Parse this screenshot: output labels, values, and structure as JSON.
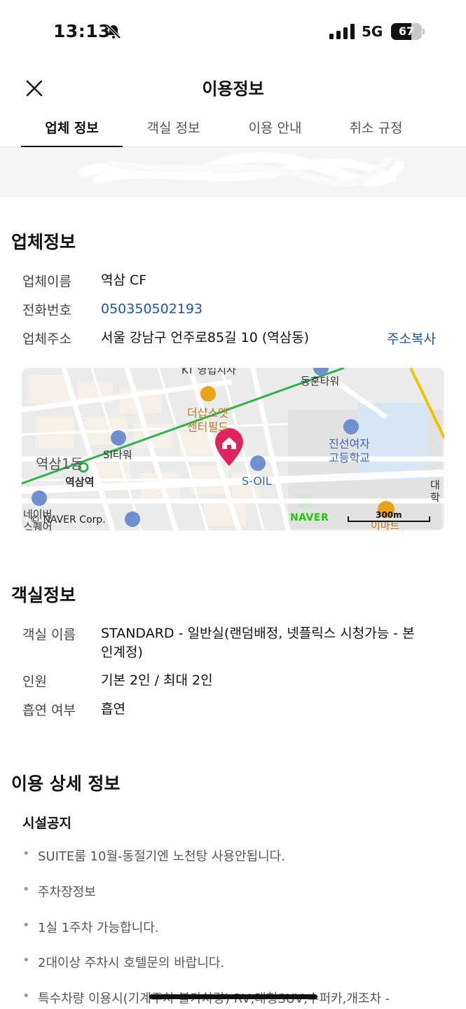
{
  "status_bar": {
    "time": "13:13",
    "network": "5G",
    "battery": "67",
    "battery_level": 0.67
  },
  "header": {
    "title": "이용정보"
  },
  "tabs": [
    {
      "label": "업체 정보"
    },
    {
      "label": "객실 정보"
    },
    {
      "label": "이용 안내"
    },
    {
      "label": "취소 규정"
    }
  ],
  "business_info": {
    "title": "업체정보",
    "name_label": "업체이름",
    "name_value": "역삼 CF",
    "phone_label": "전화번호",
    "phone_value": "050350502193",
    "address_label": "업체주소",
    "address_value": "서울 강남구 언주로85길 10 (역삼동)",
    "copy_label": "주소복사"
  },
  "map": {
    "labels": {
      "kt": "KT 영업지사",
      "donghun": "동훈타워",
      "theshop": "더샵스앳",
      "center": "센터필드",
      "si": "SI타워",
      "jinseon1": "진선여자",
      "jinseon2": "고등학교",
      "station_num": "역삼1동",
      "station": "역삼역",
      "soil": "S-OIL",
      "nebi1": "네이버",
      "nebi2": "스퀘어",
      "emart": "이마트",
      "daehak": "대학"
    },
    "copyright": "© NAVER Corp.",
    "logo": "NAVER",
    "scale": "300m",
    "colors": {
      "marker": "#e0245e",
      "subway": "#2db44a",
      "poi_orange": "#e8a317",
      "poi_blue": "#6f8fd1"
    }
  },
  "room_info": {
    "title": "객실정보",
    "name_label": "객실 이름",
    "name_value_line1": "STANDARD - 일반실(랜덤배정, 넷플릭스 시청가능 - 본",
    "name_value_line2": "인계정)",
    "capacity_label": "인원",
    "capacity_value": "기본 2인 / 최대 2인",
    "smoking_label": "흡연 여부",
    "smoking_value": "흡연"
  },
  "detail": {
    "title": "이용 상세 정보",
    "subtitle": "시설공지",
    "items": [
      "SUITE룸 10월-동절기엔 노천탕 사용안됩니다.",
      "주차장정보",
      "1실 1주차 가능합니다.",
      "2대이상 주차시 호텔문의 바랍니다.",
      "특수차량 이용시(기계주차 불가차량) RV,대형SUV,수퍼카,개조차 -"
    ]
  }
}
